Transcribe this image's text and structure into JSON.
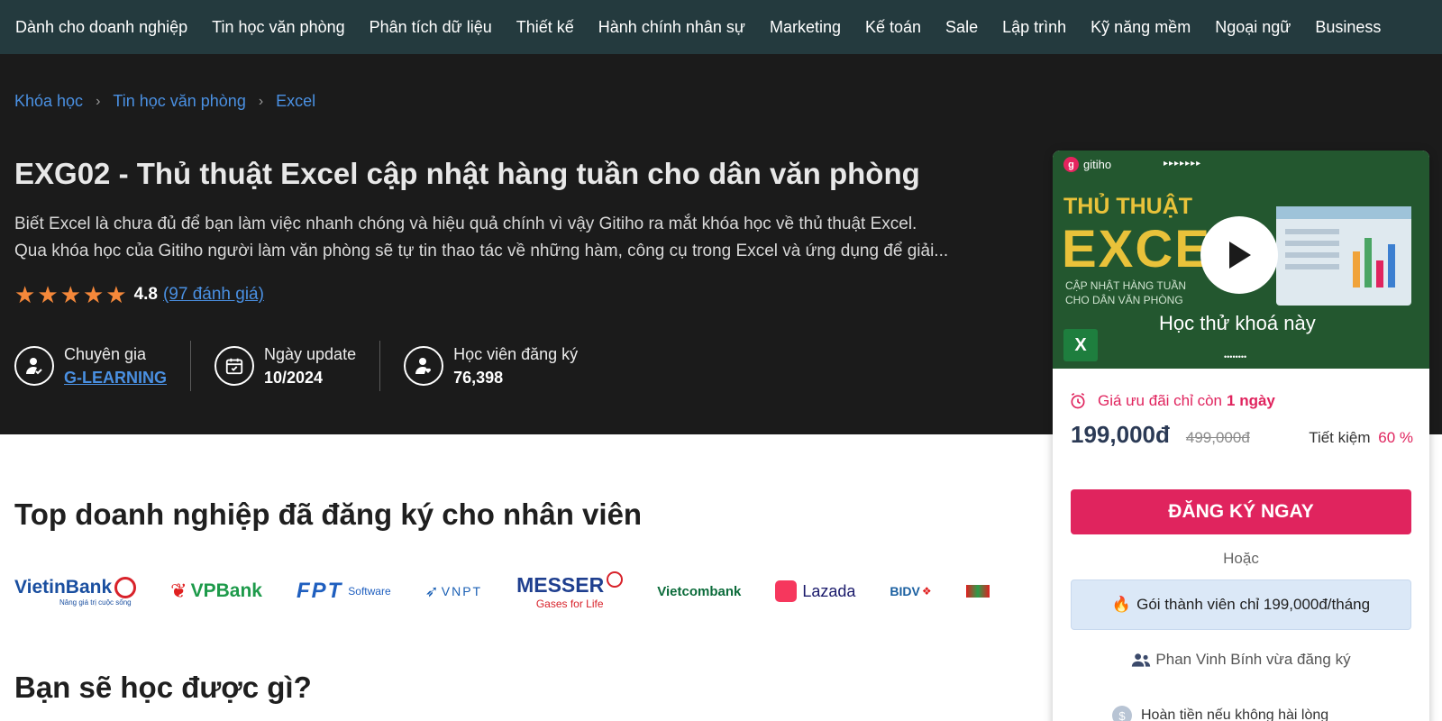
{
  "nav": {
    "items": [
      "Dành cho doanh nghiệp",
      "Tin học văn phòng",
      "Phân tích dữ liệu",
      "Thiết kế",
      "Hành chính nhân sự",
      "Marketing",
      "Kế toán",
      "Sale",
      "Lập trình",
      "Kỹ năng mềm",
      "Ngoại ngữ",
      "Business"
    ]
  },
  "breadcrumb": {
    "items": [
      "Khóa học",
      "Tin học văn phòng",
      "Excel"
    ],
    "separator_icon": "chevron-right-icon"
  },
  "course": {
    "title": "EXG02 - Thủ thuật Excel cập nhật hàng tuần cho dân văn phòng",
    "description_line1": "Biết Excel là chưa đủ để bạn làm việc nhanh chóng và hiệu quả chính vì vậy Gitiho ra mắt khóa học về thủ thuật Excel.",
    "description_line2": "Qua khóa học của Gitiho người làm văn phòng sẽ tự tin thao tác về những hàm, công cụ trong Excel và ứng dụng để giải...",
    "rating": "4.8",
    "rating_stars": 5,
    "reviews": "(97 đánh giá)",
    "star_color": "#f5883a"
  },
  "stats": {
    "expert_label": "Chuyên gia",
    "expert_value": "G-LEARNING",
    "update_label": "Ngày update",
    "update_value": "10/2024",
    "students_label": "Học viên đăng ký",
    "students_value": "76,398"
  },
  "sections": {
    "top_companies": "Top doanh nghiệp đã đăng ký cho nhân viên",
    "what_learn": "Bạn sẽ học được gì?"
  },
  "logos": {
    "vietinbank": "VietinBank",
    "vietinbank_tagline": "Nâng giá trị cuộc sống",
    "vpbank": "VPBank",
    "fpt": "FPT",
    "fpt_suffix": "Software",
    "vnpt": "VNPT",
    "messer": "MESSER",
    "messer_tagline": "Gases for Life",
    "vietcombank": "Vietcombank",
    "lazada": "Lazada",
    "bidv": "BIDV"
  },
  "card": {
    "thumb": {
      "brand": "gitiho",
      "dots_top": "▸▸▸▸▸▸▸",
      "headline1": "THỦ THUẬT",
      "headline2": "EXCEL",
      "sub_line1": "CẬP NHẬT HÀNG TUẦN",
      "sub_line2": "CHO DÂN VĂN PHÒNG",
      "trial_label": "Học thử khoá này",
      "dots_bottom": "••••••••"
    },
    "promo_prefix": "Giá ưu đãi chỉ còn",
    "promo_days": "1 ngày",
    "price": "199,000đ",
    "old_price": "499,000đ",
    "saving_label": "Tiết kiệm",
    "saving_pct": "60 %",
    "cta": "ĐĂNG KÝ NGAY",
    "or": "Hoặc",
    "member_offer": "Gói thành viên chỉ 199,000đ/tháng",
    "recent_signup": "Phan Vinh Bính vừa đăng ký",
    "refund": "Hoàn tiền nếu không hài lòng",
    "accent_color": "#e0245e",
    "price_color": "#2b3a55"
  }
}
